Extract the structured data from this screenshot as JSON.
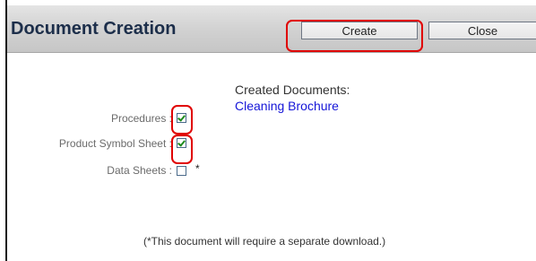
{
  "header": {
    "title": "Document Creation",
    "create_label": "Create",
    "close_label": "Close"
  },
  "options": [
    {
      "label": "Procedures :",
      "checked": true
    },
    {
      "label": "Product Symbol Sheet :",
      "checked": true
    },
    {
      "label": "Data Sheets :",
      "checked": false,
      "note_marker": "*"
    }
  ],
  "created_documents": {
    "heading": "Created Documents:",
    "items": [
      "Cleaning Brochure"
    ]
  },
  "footnote": "(*This document will require a separate download.)",
  "colors": {
    "title": "#1c2e4a",
    "link": "#1515d8",
    "highlight": "#e00000",
    "checkmark": "#1c8a1c",
    "label": "#6b6b6b"
  }
}
